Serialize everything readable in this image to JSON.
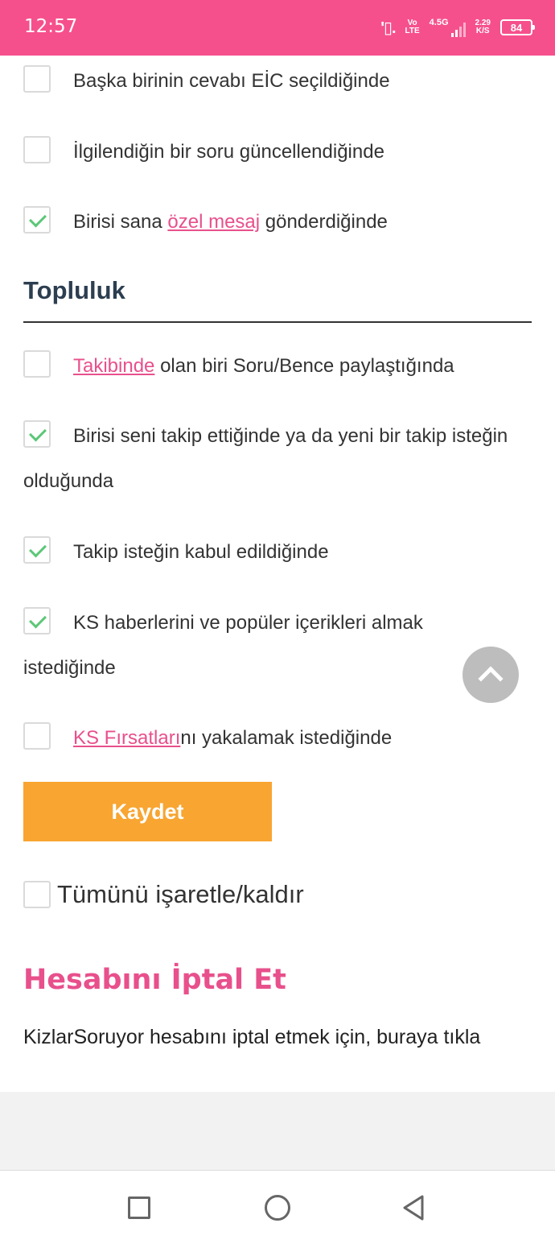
{
  "status_bar": {
    "time": "12:57",
    "volte_top": "Vo",
    "volte_bottom": "LTE",
    "network": "4.5G",
    "speed_value": "2.29",
    "speed_unit": "K/S",
    "battery": "84"
  },
  "notifications": [
    {
      "text": "Başka birinin cevabı EİC seçildiğinde",
      "checked": false
    },
    {
      "text": "İlgilendiğin bir soru güncellendiğinde",
      "checked": false
    },
    {
      "pre": "Birisi sana ",
      "link": "özel mesaj",
      "post": " gönderdiğinde",
      "checked": true
    }
  ],
  "community": {
    "title": "Topluluk",
    "items": [
      {
        "link": "Takibinde",
        "post": " olan biri Soru/Bence paylaştığında",
        "checked": false
      },
      {
        "text": "Birisi seni takip ettiğinde ya da yeni bir takip isteğin olduğunda",
        "checked": true
      },
      {
        "text": "Takip isteğin kabul edildiğinde",
        "checked": true
      },
      {
        "text": "KS haberlerini ve popüler içerikleri almak istediğinde",
        "checked": true
      },
      {
        "link": "KS Fırsatları",
        "post": "nı yakalamak istediğinde",
        "checked": false
      }
    ]
  },
  "save_label": "Kaydet",
  "toggle_all_label": "Tümünü işaretle/kaldır",
  "cancel": {
    "title": "Hesabını İptal Et",
    "text": "KizlarSoruyor hesabını iptal etmek için, buraya tıkla"
  },
  "colors": {
    "status_bar": "#f6508c",
    "link": "#e8508c",
    "save_button": "#f8a532",
    "check": "#5cc777",
    "heading": "#2c3e50"
  },
  "icons": {
    "scroll_top": "chevron-up-icon",
    "nav": [
      "recent-apps-icon",
      "home-icon",
      "back-icon"
    ]
  }
}
